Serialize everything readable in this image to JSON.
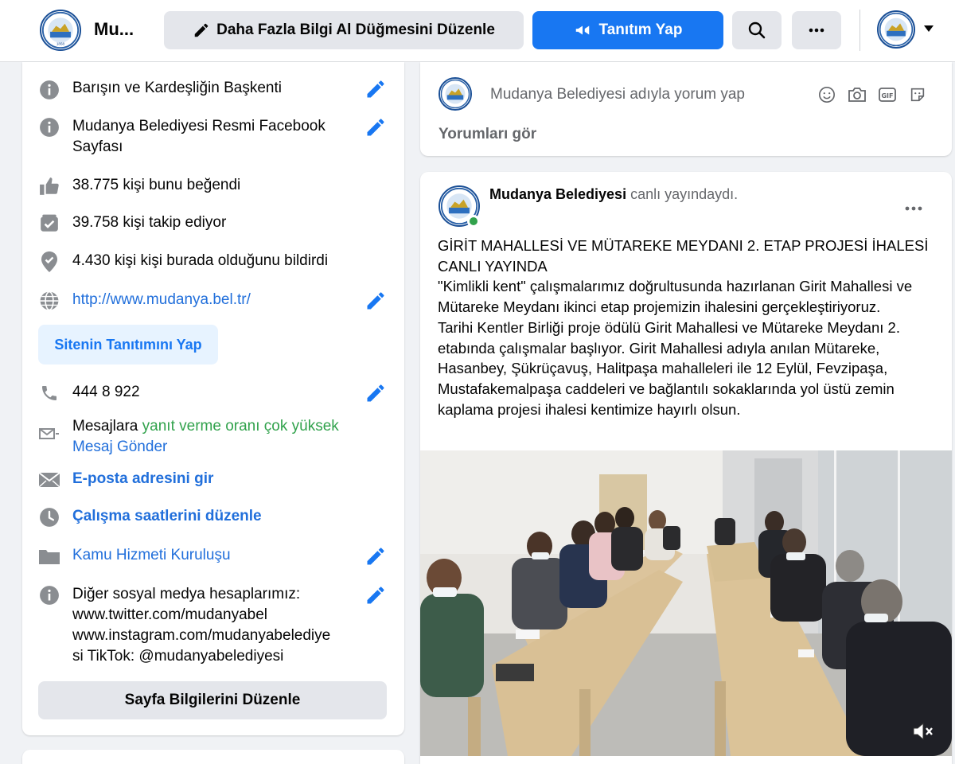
{
  "header": {
    "page_name": "Mu...",
    "edit_button_label": "Daha Fazla Bilgi Al Düğmesini Düzenle",
    "promote_button_label": "Tanıtım Yap",
    "search_icon": "search-icon",
    "more_icon": "more-horizontal-icon",
    "account_caret_icon": "chevron-down-icon"
  },
  "about": {
    "slogan": "Barışın ve Kardeşliğin Başkenti",
    "description": "Mudanya Belediyesi Resmi Facebook Sayfası",
    "likes": "38.775 kişi bunu beğendi",
    "followers": "39.758 kişi takip ediyor",
    "checkins": "4.430 kişi kişi burada olduğunu bildirdi",
    "website": "http://www.mudanya.bel.tr/",
    "promote_site_label": "Sitenin Tanıtımını Yap",
    "phone": "444 8 922",
    "messages_prefix": "Mesajlara ",
    "messages_rate": "yanıt verme oranı çok yüksek",
    "send_message": "Mesaj Gönder",
    "email_prompt": "E-posta adresini gir",
    "hours_prompt": "Çalışma saatlerini düzenle",
    "category": "Kamu Hizmeti Kuruluşu",
    "social_line1": "Diğer sosyal medya hesaplarımız:",
    "social_line2": "www.twitter.com/mudanyabel",
    "social_line3": "www.instagram.com/mudanyabelediye",
    "social_line4": "si TikTok: @mudanyabelediyesi",
    "edit_page_info_label": "Sayfa Bilgilerini Düzenle"
  },
  "comment_box": {
    "placeholder": "Mudanya Belediyesi adıyla yorum yap",
    "see_comments": "Yorumları gör",
    "tools": [
      "emoji-icon",
      "camera-icon",
      "gif-icon",
      "sticker-icon"
    ]
  },
  "post": {
    "author": "Mudanya Belediyesi",
    "status": " canlı yayındaydı.",
    "text": "GİRİT MAHALLESİ VE MÜTAREKE MEYDANI 2. ETAP PROJESİ İHALESİ CANLI YAYINDA\n\"Kimlikli kent\" çalışmalarımız doğrultusunda hazırlanan Girit Mahallesi ve Mütareke Meydanı ikinci etap projemizin ihalesini gerçekleştiriyoruz.\nTarihi Kentler Birliği proje ödülü Girit Mahallesi ve Mütareke Meydanı 2. etabında çalışmalar başlıyor. Girit Mahallesi adıyla anılan Mütareke, Hasanbey, Şükrüçavuş, Halitpaşa mahalleleri ile 12 Eylül, Fevzipaşa, Mustafakemalpaşa caddeleri ve bağlantılı sokaklarında yol üstü zemin kaplama projesi ihalesi kentimize hayırlı olsun.",
    "more_icon": "more-horizontal-icon",
    "media_icon": "volume-muted-icon"
  },
  "colors": {
    "accent": "#1877f2",
    "link": "#216fdb",
    "online": "#31a24c",
    "icon_gray": "#65676b"
  }
}
